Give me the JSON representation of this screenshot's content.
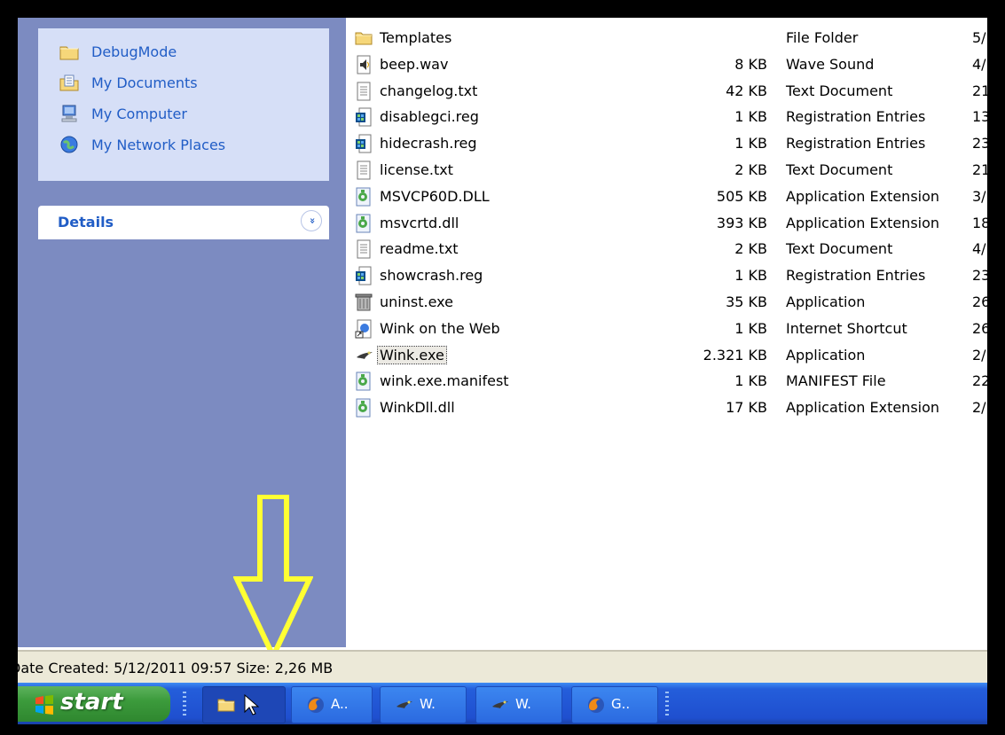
{
  "task_pane": {
    "places": [
      {
        "label": "DebugMode",
        "icon": "folder-icon"
      },
      {
        "label": "My Documents",
        "icon": "my-documents-icon"
      },
      {
        "label": "My Computer",
        "icon": "computer-icon"
      },
      {
        "label": "My Network Places",
        "icon": "network-icon"
      }
    ],
    "details_title": "Details",
    "details_chevron": "»"
  },
  "files": [
    {
      "name": "Templates",
      "size": "",
      "type": "File Folder",
      "date": "5/",
      "icon": "folder-icon"
    },
    {
      "name": "beep.wav",
      "size": "8 KB",
      "type": "Wave Sound",
      "date": "4/",
      "icon": "sound-file-icon"
    },
    {
      "name": "changelog.txt",
      "size": "42 KB",
      "type": "Text Document",
      "date": "21",
      "icon": "text-file-icon"
    },
    {
      "name": "disablegci.reg",
      "size": "1 KB",
      "type": "Registration Entries",
      "date": "13",
      "icon": "registry-file-icon"
    },
    {
      "name": "hidecrash.reg",
      "size": "1 KB",
      "type": "Registration Entries",
      "date": "23",
      "icon": "registry-file-icon"
    },
    {
      "name": "license.txt",
      "size": "2 KB",
      "type": "Text Document",
      "date": "21",
      "icon": "text-file-icon"
    },
    {
      "name": "MSVCP60D.DLL",
      "size": "505 KB",
      "type": "Application Extension",
      "date": "3/",
      "icon": "dll-file-icon"
    },
    {
      "name": "msvcrtd.dll",
      "size": "393 KB",
      "type": "Application Extension",
      "date": "18",
      "icon": "dll-file-icon"
    },
    {
      "name": "readme.txt",
      "size": "2 KB",
      "type": "Text Document",
      "date": "4/",
      "icon": "text-file-icon"
    },
    {
      "name": "showcrash.reg",
      "size": "1 KB",
      "type": "Registration Entries",
      "date": "23",
      "icon": "registry-file-icon"
    },
    {
      "name": "uninst.exe",
      "size": "35 KB",
      "type": "Application",
      "date": "26",
      "icon": "uninstaller-icon"
    },
    {
      "name": "Wink on the Web",
      "size": "1 KB",
      "type": "Internet Shortcut",
      "date": "26",
      "icon": "internet-shortcut-icon"
    },
    {
      "name": "Wink.exe",
      "size": "2.321 KB",
      "type": "Application",
      "date": "2/",
      "icon": "wink-app-icon",
      "selected": true
    },
    {
      "name": "wink.exe.manifest",
      "size": "1 KB",
      "type": "MANIFEST File",
      "date": "22",
      "icon": "dll-file-icon"
    },
    {
      "name": "WinkDll.dll",
      "size": "17 KB",
      "type": "Application Extension",
      "date": "2/",
      "icon": "dll-file-icon"
    }
  ],
  "status_bar": {
    "text": "Date Created: 5/12/2011 09:57 Size: 2,26 MB"
  },
  "taskbar": {
    "start_label": "start",
    "tasks": [
      {
        "label": "",
        "icon": "folder-icon",
        "active": true
      },
      {
        "label": "A..",
        "icon": "firefox-icon"
      },
      {
        "label": "W.",
        "icon": "wink-app-icon"
      },
      {
        "label": "W.",
        "icon": "wink-app-icon"
      },
      {
        "label": "G..",
        "icon": "firefox-icon"
      }
    ]
  },
  "colors": {
    "task_pane_bg": "#7c8bc1",
    "places_box_bg": "#d6dff7",
    "link_blue": "#215dc6",
    "taskbar_blue": "#245edb",
    "start_green": "#3c9b3c",
    "arrow_yellow": "#ffff33"
  }
}
